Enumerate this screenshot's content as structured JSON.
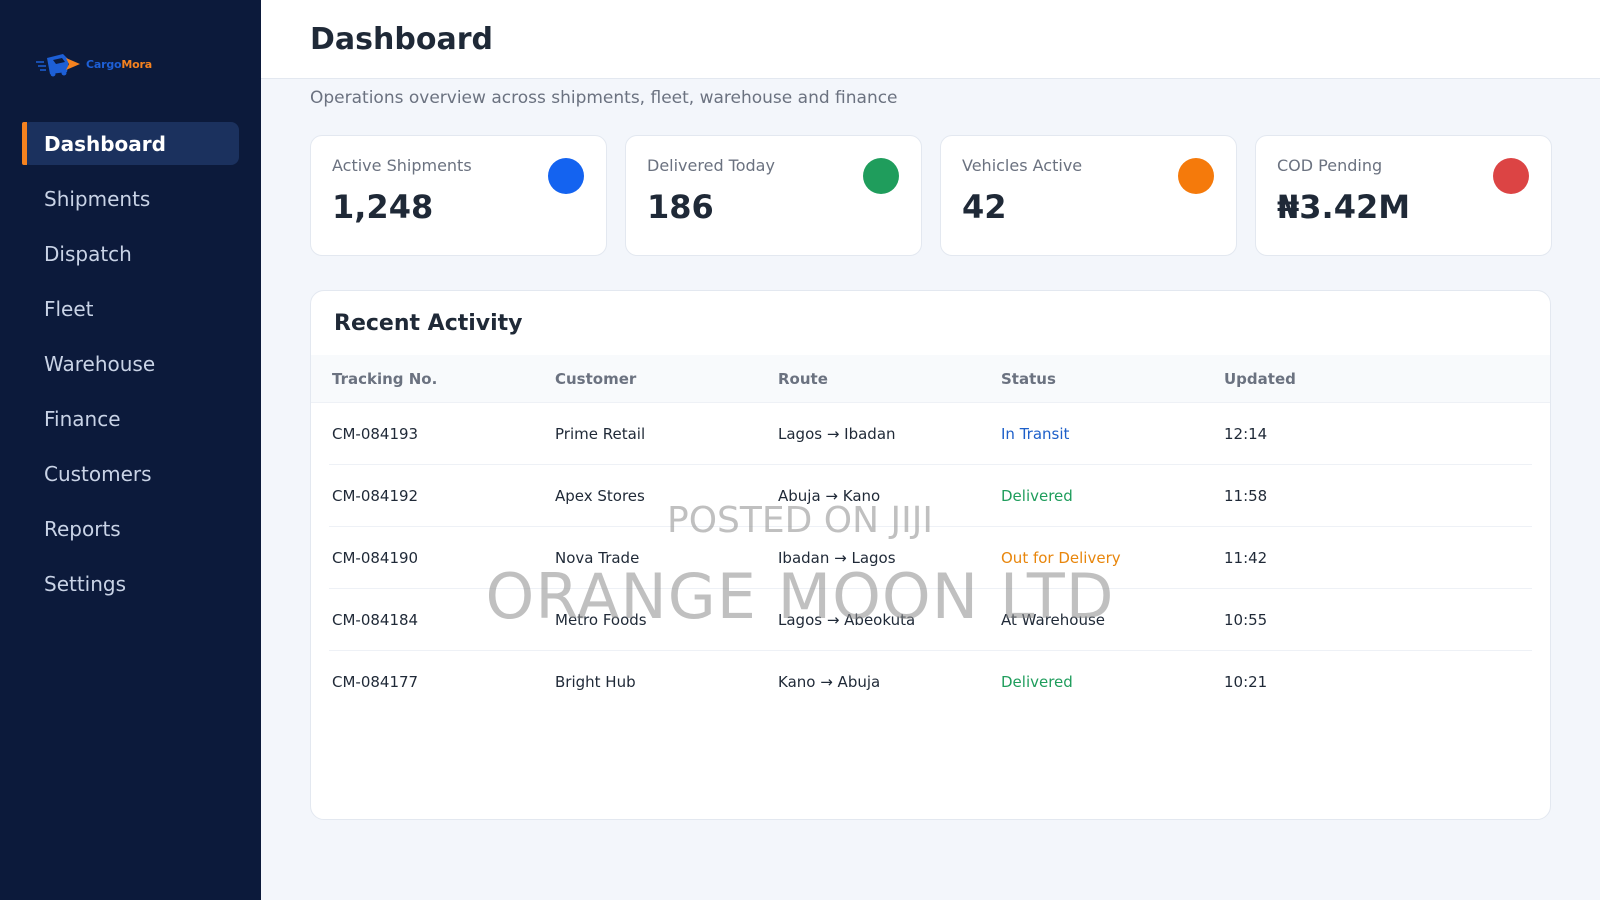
{
  "brand": {
    "name_part1": "Cargo",
    "name_part2": "Mora"
  },
  "colors": {
    "sidebar_bg": "#0c1a3b",
    "accent": "#f5821f",
    "primary": "#1d5fd6"
  },
  "sidebar": {
    "items": [
      {
        "label": "Dashboard",
        "active": true
      },
      {
        "label": "Shipments",
        "active": false
      },
      {
        "label": "Dispatch",
        "active": false
      },
      {
        "label": "Fleet",
        "active": false
      },
      {
        "label": "Warehouse",
        "active": false
      },
      {
        "label": "Finance",
        "active": false
      },
      {
        "label": "Customers",
        "active": false
      },
      {
        "label": "Reports",
        "active": false
      },
      {
        "label": "Settings",
        "active": false
      }
    ]
  },
  "header": {
    "title": "Dashboard",
    "subtitle": "Operations overview across shipments, fleet, warehouse and finance"
  },
  "stats": [
    {
      "label": "Active Shipments",
      "value": "1,248",
      "color": "#1463f0"
    },
    {
      "label": "Delivered Today",
      "value": "186",
      "color": "#1f9d5c"
    },
    {
      "label": "Vehicles Active",
      "value": "42",
      "color": "#f57a0b"
    },
    {
      "label": "COD Pending",
      "value": "₦3.42M",
      "color": "#dc4444"
    }
  ],
  "activity": {
    "title": "Recent Activity",
    "columns": [
      "Tracking No.",
      "Customer",
      "Route",
      "Status",
      "Updated"
    ],
    "rows": [
      {
        "tracking": "CM-084193",
        "customer": "Prime Retail",
        "route": "Lagos → Ibadan",
        "status": "In Transit",
        "updated": "12:14"
      },
      {
        "tracking": "CM-084192",
        "customer": "Apex Stores",
        "route": "Abuja → Kano",
        "status": "Delivered",
        "updated": "11:58"
      },
      {
        "tracking": "CM-084190",
        "customer": "Nova Trade",
        "route": "Ibadan → Lagos",
        "status": "Out for Delivery",
        "updated": "11:42"
      },
      {
        "tracking": "CM-084184",
        "customer": "Metro Foods",
        "route": "Lagos → Abeokuta",
        "status": "At Warehouse",
        "updated": "10:55"
      },
      {
        "tracking": "CM-084177",
        "customer": "Bright Hub",
        "route": "Kano → Abuja",
        "status": "Delivered",
        "updated": "10:21"
      }
    ]
  },
  "watermark": {
    "line1": "POSTED ON JIJI",
    "line2": "ORANGE MOON LTD"
  }
}
